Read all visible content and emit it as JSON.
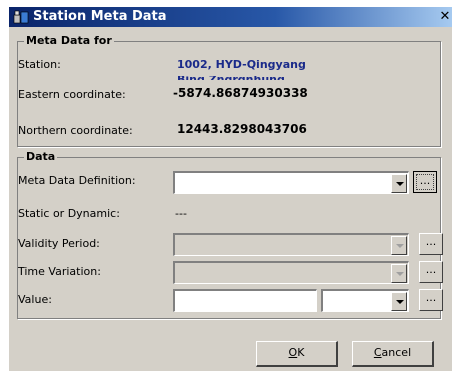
{
  "window": {
    "title": "Station Meta Data",
    "close_glyph": "✕"
  },
  "meta_group": {
    "legend": "Meta Data for",
    "station_label": "Station:",
    "station_value": "1002, HYD-Qingyang",
    "station_value_overflow": "Bing Zngrgnhung",
    "eastern_label": "Eastern coordinate:",
    "eastern_value": "-5874.86874930338",
    "northern_label": "Northern coordinate:",
    "northern_value": "12443.8298043706"
  },
  "data_group": {
    "legend": "Data",
    "definition_label": "Meta Data Definition:",
    "definition_value": "",
    "static_label": "Static or Dynamic:",
    "static_value": "---",
    "validity_label": "Validity Period:",
    "validity_value": "",
    "timevar_label": "Time Variation:",
    "timevar_value": "",
    "value_label": "Value:",
    "value_text": "",
    "value_unit": "",
    "ellipsis": "..."
  },
  "buttons": {
    "ok_accel": "O",
    "ok_rest": "K",
    "cancel_accel": "C",
    "cancel_rest": "ancel"
  },
  "colors": {
    "titlebar": "#0a246a",
    "face": "#d4d0c8",
    "value_blue": "#1a2a8a"
  },
  "icons": {
    "title": "station-app-icon",
    "close": "close-icon",
    "dropdown": "chevron-down-icon"
  }
}
